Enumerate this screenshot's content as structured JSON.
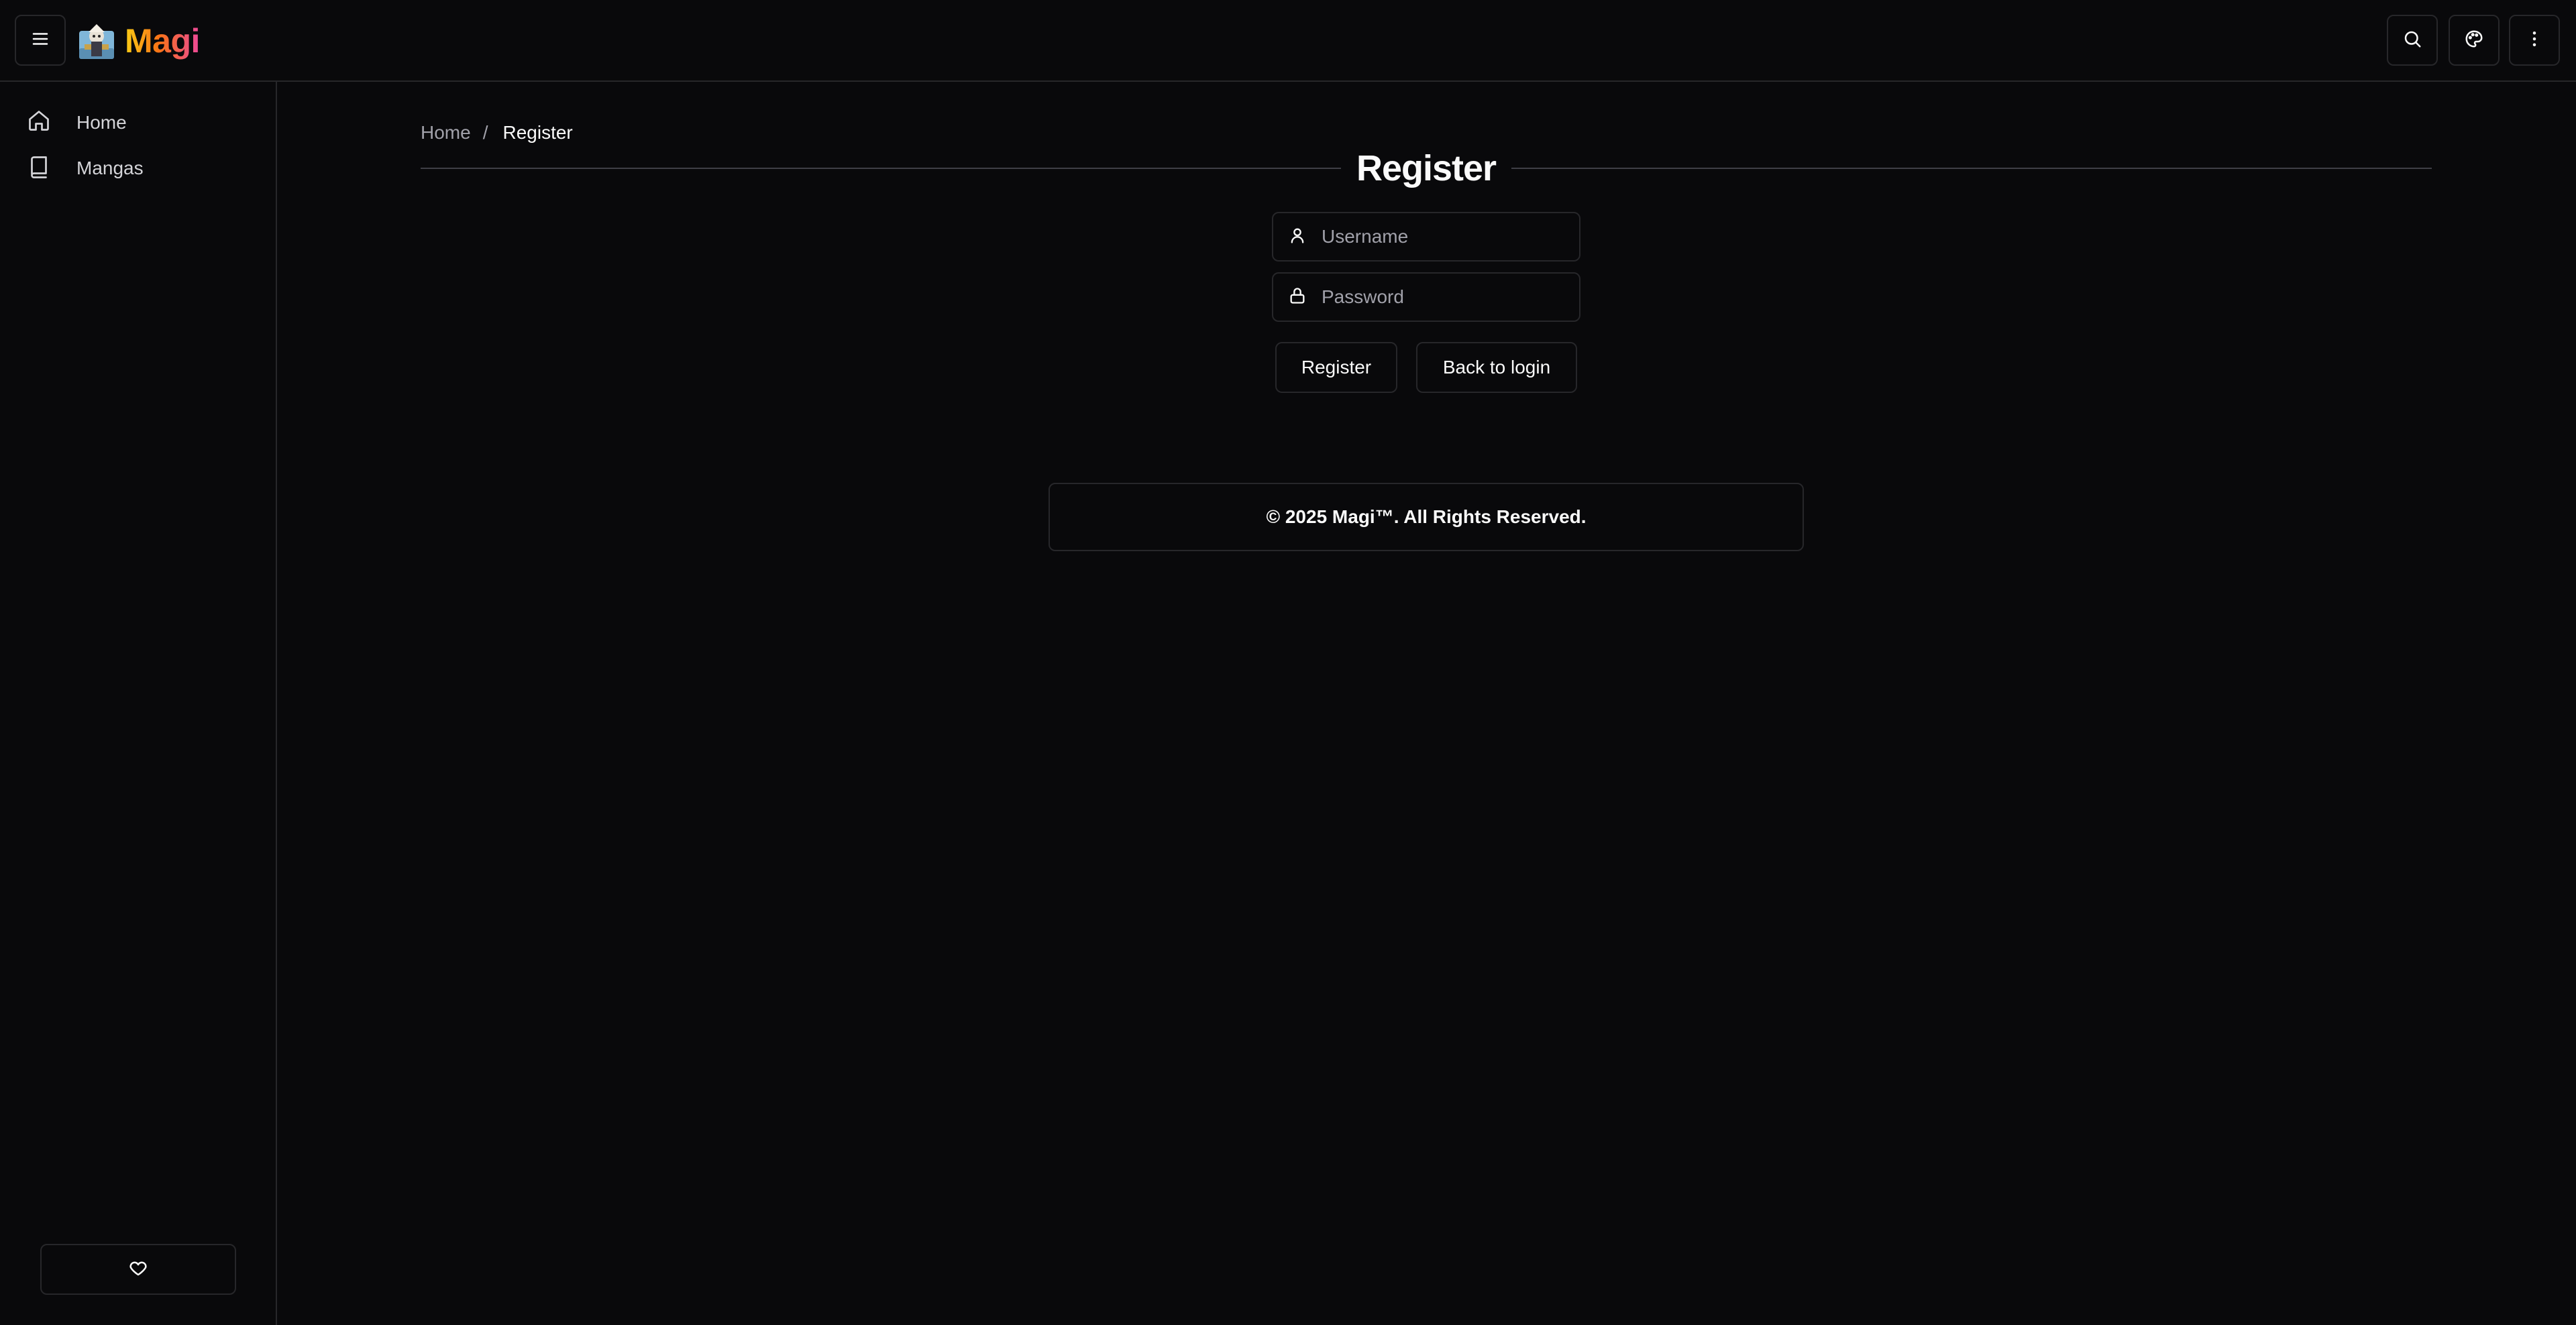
{
  "header": {
    "brand": "Magi",
    "icons": {
      "menu": "menu-icon",
      "logo": "magi-logo",
      "search": "search-icon",
      "theme": "palette-icon",
      "more": "more-vertical-icon"
    }
  },
  "sidebar": {
    "items": [
      {
        "label": "Home",
        "icon": "home-icon"
      },
      {
        "label": "Mangas",
        "icon": "book-icon"
      }
    ],
    "bottom_icon": "heart-icon"
  },
  "breadcrumb": {
    "home": "Home",
    "separator": "/",
    "current": "Register"
  },
  "page": {
    "title": "Register"
  },
  "form": {
    "username": {
      "placeholder": "Username",
      "value": "",
      "icon": "user-icon"
    },
    "password": {
      "placeholder": "Password",
      "value": "",
      "icon": "lock-icon"
    },
    "register_label": "Register",
    "back_label": "Back to login"
  },
  "footer": {
    "text": "© 2025 Magi™. All Rights Reserved."
  },
  "colors": {
    "background": "#09090b",
    "border": "#27272a",
    "text": "#fafafa",
    "muted": "#a1a1aa",
    "brand_gradient": [
      "#facc15",
      "#f97316",
      "#ec4899"
    ]
  }
}
